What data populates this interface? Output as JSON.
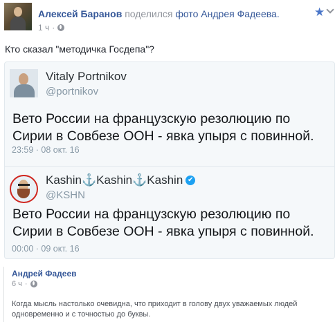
{
  "post": {
    "author": "Алексей Баранов",
    "shared_text": "поделился",
    "photo_link": "фото Андрея Фадеева.",
    "time": "1 ч",
    "text": "Кто сказал \"методичка Госдепа\"?"
  },
  "tweets": [
    {
      "name": "Vitaly Portnikov",
      "handle": "@portnikov",
      "text": "Вето России на французскую резолюцию по Сирии в Совбезе ООН - явка упыря с повинной.",
      "date": "23:59 · 08 окт. 16"
    },
    {
      "name": "Kashin⚓Kashin⚓Kashin",
      "handle": "@KSHN",
      "text": "Вето России на французскую резолюцию по Сирии в Совбезе ООН - явка упыря с повинной.",
      "date": "00:00 · 09 окт. 16",
      "verified": "✔"
    }
  ],
  "comment": {
    "author": "Андрей Фадеев",
    "time": "6 ч",
    "text": "Когда мысль настолько очевидна, что приходит в голову двух уважаемых людей одновременно и с точностью до буквы."
  },
  "icons": {
    "star": "★",
    "globe": "globe-icon",
    "chevron": "chevron-down-icon"
  },
  "colors": {
    "link": "#365899",
    "muted": "#90949c",
    "star": "#4a76c9",
    "verified": "#1da1f2"
  }
}
